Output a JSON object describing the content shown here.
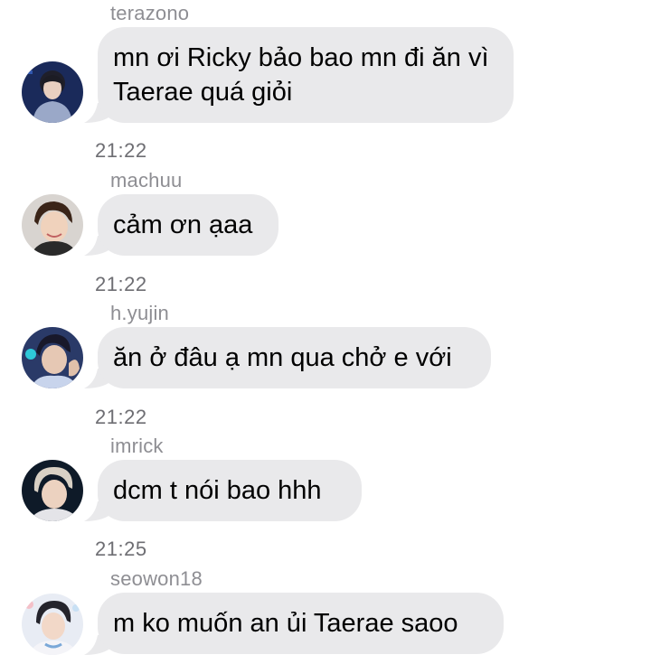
{
  "messages": [
    {
      "username": "terazono",
      "text": "mn ơi Ricky bảo bao mn đi ăn vì Taerae quá giỏi",
      "time": "21:22",
      "avatar_icon": "user-avatar-icon"
    },
    {
      "username": "machuu",
      "text": "cảm ơn ạaa",
      "time": "21:22",
      "avatar_icon": "user-avatar-icon"
    },
    {
      "username": "h.yujin",
      "text": "ăn ở đâu ạ mn qua chở e với",
      "time": "21:22",
      "avatar_icon": "user-avatar-icon"
    },
    {
      "username": "imrick",
      "text": "dcm t nói bao hhh",
      "time": "21:25",
      "avatar_icon": "user-avatar-icon"
    },
    {
      "username": "seowon18",
      "text": "m ko muốn an ủi Taerae saoo",
      "avatar_icon": "user-avatar-icon"
    }
  ],
  "colors": {
    "bubble_bg": "#e9e9eb",
    "username": "#8e8e93",
    "time": "#6e6e73",
    "background": "#ffffff"
  }
}
